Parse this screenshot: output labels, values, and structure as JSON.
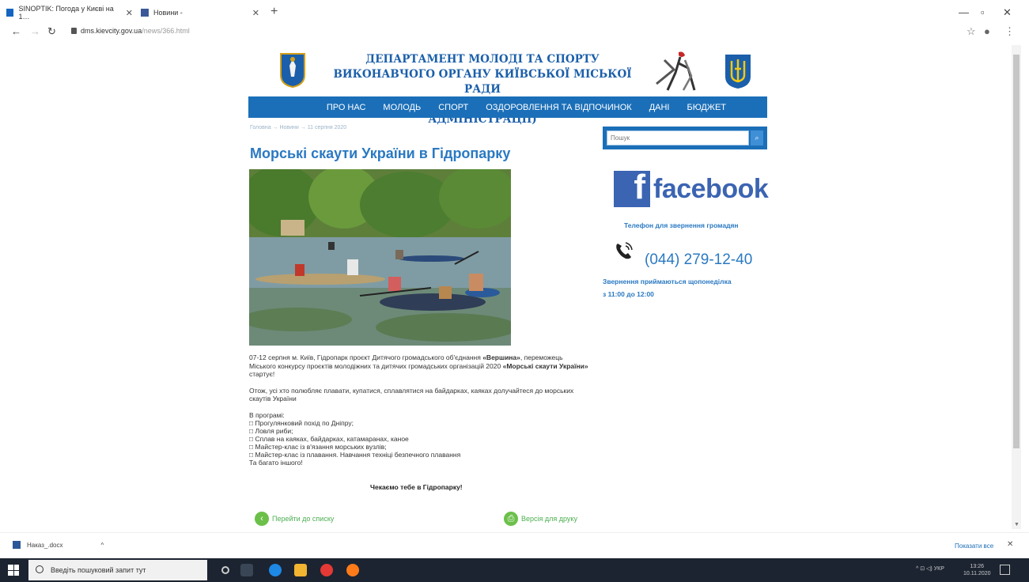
{
  "browser": {
    "tabs": [
      {
        "title": "SINOPTIK: Погода у Києві на 1…"
      },
      {
        "title": "Новини -"
      }
    ],
    "url_host": "dms.kievcity.gov.ua",
    "url_path": "/news/366.html"
  },
  "header": {
    "title_line1": "ДЕПАРТАМЕНТ МОЛОДІ ТА СПОРТУ",
    "title_line2": "ВИКОНАВЧОГО ОРГАНУ КИЇВСЬКОЇ МІСЬКОЇ РАДИ",
    "title_line3": "(КИЇВСЬКОЇ МІСЬКОЇ ДЕРЖАВНОЇ АДМІНІСТРАЦІЇ)"
  },
  "nav": {
    "items": [
      "ПРО НАС",
      "МОЛОДЬ",
      "СПОРТ",
      "ОЗДОРОВЛЕННЯ ТА ВІДПОЧИНОК",
      "ДАНІ",
      "БЮДЖЕТ"
    ]
  },
  "breadcrumb": "Головна → Новини → 11 серпня 2020",
  "article": {
    "title": "Морські скаути України в Гідропарку",
    "para1_start": "07-12 серпня м. Київ, Гідропарк проєкт Дитячого громадського об'єднання ",
    "para1_bold1": "«Вершина»",
    "para1_mid": ", переможець Міського конкурсу проєктів молодіжних та дитячих громадських організацій 2020 ",
    "para1_bold2": "«Морські скаути України»",
    "para1_end": " стартує!",
    "para2": "Отож, усі хто полюбляє плавати, купатися, сплавлятися на байдарках, каяках долучайтеся до морських скаутів України",
    "program_title": "В програмі:",
    "program_items": [
      "Прогулянковий похід по Дніпру;",
      "Ловля риби;",
      "Сплав на каяках, байдарках, катамаранах, каное",
      "Майстер-клас із в'язання морських вузлів;",
      "Майстер-клас із плавання. Навчання техніці безпечного плавання"
    ],
    "program_footer": "Та багато іншого!",
    "closing": "Чекаємо тебе в Гідропарку!",
    "back_link": "Перейти до списку",
    "print_link": "Версія для друку"
  },
  "sidebar": {
    "search_placeholder": "Пошук",
    "facebook_label": "facebook",
    "phone_title": "Телефон для звернення громадян",
    "phone_number": "(044) 279-12-40",
    "phone_note_line1": "Звернення приймаються щопонеділка",
    "phone_note_line2": "з 11:00 до 12:00"
  },
  "downloads": {
    "file": "Наказ_.docx",
    "show_all": "Показати все"
  },
  "taskbar": {
    "search_placeholder": "Введіть пошуковий запит тут",
    "lang": "УКР",
    "time": "13:26",
    "date": "10.11.2020"
  },
  "colors": {
    "accent_blue": "#1b6fb8",
    "title_blue": "#2a79c2",
    "facebook_blue": "#3b64b2",
    "link_green": "#4caf50"
  }
}
